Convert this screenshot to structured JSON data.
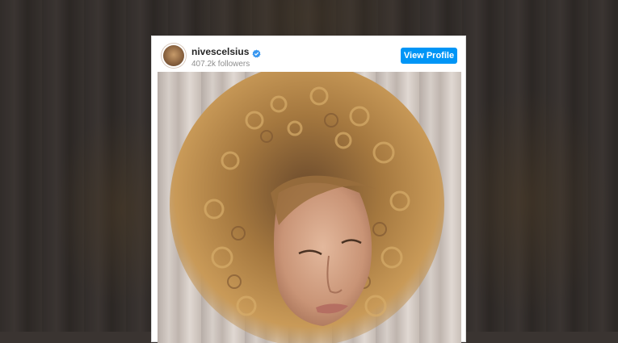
{
  "embed": {
    "username": "nivescelsius",
    "followers": "407.2k followers",
    "view_profile_label": "View Profile",
    "verified_icon": "verified-badge-icon",
    "accent_color": "#0095f6"
  }
}
